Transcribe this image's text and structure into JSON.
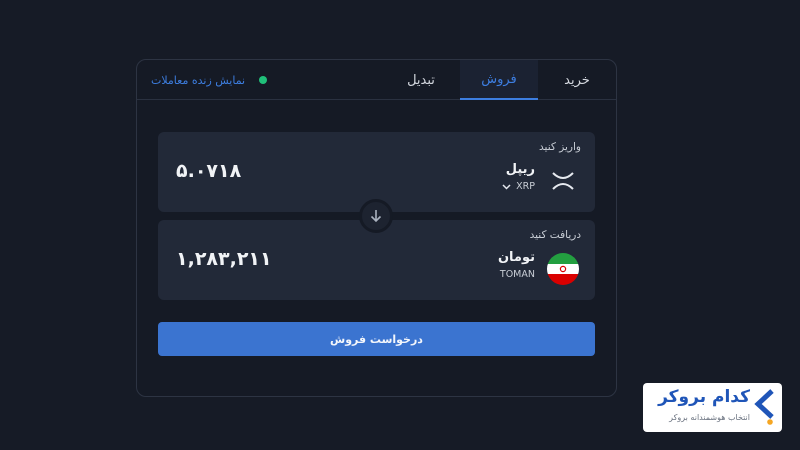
{
  "tabs": {
    "buy": "خرید",
    "sell": "فروش",
    "convert": "تبدیل",
    "active": "sell"
  },
  "live_trades": {
    "label": "نمایش زنده معاملات",
    "status_color": "#20c07a"
  },
  "pay": {
    "label": "واریز کنید",
    "amount": "۵.۰۷۱۸",
    "asset_name": "ریپل",
    "asset_code": "XRP",
    "icon": "xrp-icon"
  },
  "receive": {
    "label": "دریافت کنید",
    "amount": "۱,۲۸۳,۲۱۱",
    "asset_name": "تومان",
    "asset_code": "TOMAN",
    "icon": "iran-flag-icon"
  },
  "submit_label": "درخواست فروش",
  "brand": {
    "name": "کدام بروکر",
    "tagline": "انتخاب هوشمندانه بروکر"
  },
  "colors": {
    "accent": "#3b74d0",
    "background": "#161b26",
    "panel": "#222938"
  }
}
